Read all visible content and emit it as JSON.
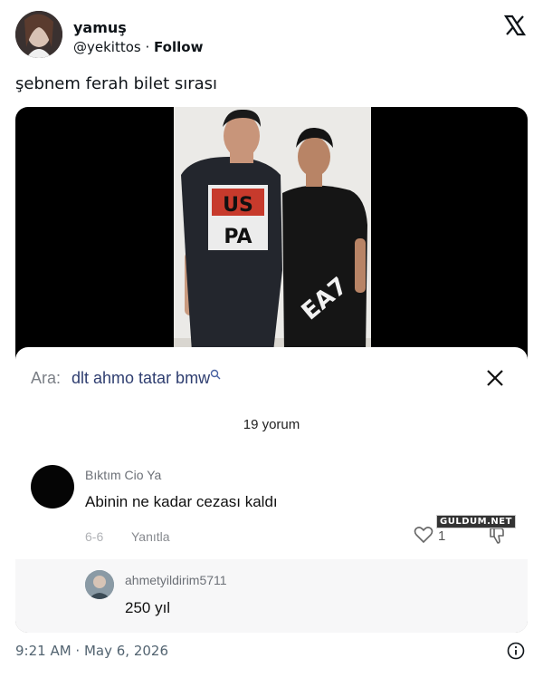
{
  "author": {
    "display_name": "yamuş",
    "handle": "@yekittos",
    "separator": " · ",
    "follow_label": "Follow"
  },
  "tweet": {
    "text": "şebnem ferah bilet sırası",
    "timestamp": "9:21 AM · May 6, 2026"
  },
  "media": {
    "shirt_left_line1": "US",
    "shirt_left_line2": "PA",
    "shirt_right_text": "EA7",
    "search_label": "Ara:",
    "search_query": "dlt ahmo tatar bmw",
    "comment_count": "19 yorum",
    "comments": [
      {
        "user": "Bıktım Cio Ya",
        "text": "Abinin ne kadar cezası kaldı",
        "date": "6-6",
        "reply_label": "Yanıtla",
        "likes": "1"
      },
      {
        "user": "ahmetyildirim5711",
        "text": "250 yıl"
      }
    ],
    "watermark": "GULDUM.NET"
  },
  "icons": {
    "x_logo": "x-logo-icon",
    "close": "close-icon",
    "search": "search-icon",
    "heart": "heart-icon",
    "dislike": "thumbs-down-icon",
    "info": "info-icon"
  }
}
